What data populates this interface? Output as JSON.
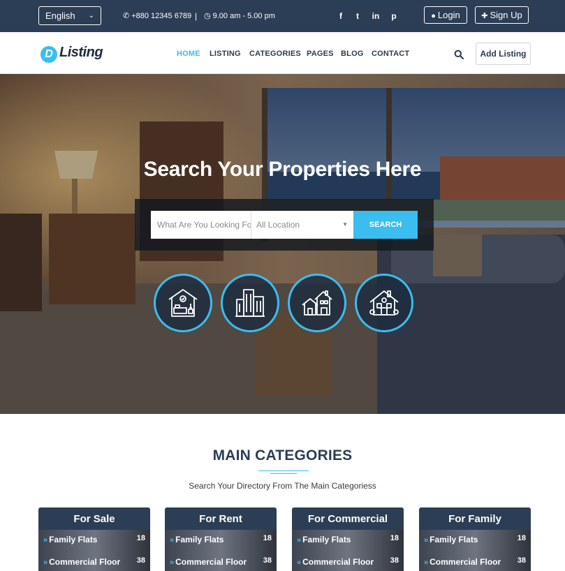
{
  "topbar": {
    "language": "English",
    "phone": "+880 12345 6789",
    "separator": "|",
    "hours": "9.00 am - 5.00 pm",
    "social": [
      "f",
      "t",
      "in",
      "p"
    ],
    "login_label": "Login",
    "signup_label": "Sign Up"
  },
  "nav": {
    "logo_mark": "D",
    "logo_text": "Listing",
    "links": [
      "HOME",
      "LISTING",
      "CATEGORIES",
      "PAGES",
      "BLOG",
      "CONTACT"
    ],
    "active_index": 0,
    "add_listing_label": "Add Listing"
  },
  "hero": {
    "title": "Search Your Properties Here",
    "search_placeholder": "What Are You Looking For?",
    "location_value": "All Location",
    "search_button": "SEARCH",
    "icons": [
      "bedroom-icon",
      "buildings-icon",
      "houses-icon",
      "family-house-icon"
    ]
  },
  "categories": {
    "title": "MAIN CATEGORIES",
    "subtitle": "Search Your Directory From The Main Categoriess",
    "cards": [
      {
        "title": "For Sale",
        "rows": [
          {
            "label": "Family Flats",
            "count": "18"
          },
          {
            "label": "Commercial Floor",
            "count": "38"
          }
        ]
      },
      {
        "title": "For Rent",
        "rows": [
          {
            "label": "Family Flats",
            "count": "18"
          },
          {
            "label": "Commercial Floor",
            "count": "38"
          }
        ]
      },
      {
        "title": "For Commercial",
        "rows": [
          {
            "label": "Family Flats",
            "count": "18"
          },
          {
            "label": "Commercial Floor",
            "count": "38"
          }
        ]
      },
      {
        "title": "For Family",
        "rows": [
          {
            "label": "Family Flats",
            "count": "18"
          },
          {
            "label": "Commercial Floor",
            "count": "38"
          }
        ]
      }
    ]
  },
  "colors": {
    "navy": "#2c3e55",
    "accent": "#3bbdf0",
    "white": "#ffffff"
  }
}
